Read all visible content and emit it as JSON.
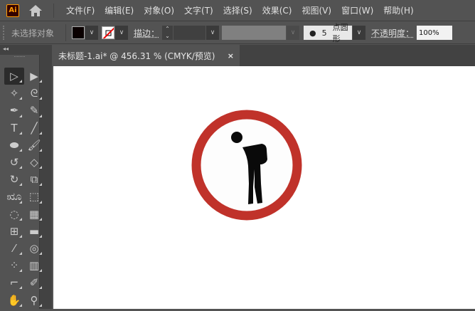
{
  "app": {
    "logo": "Ai"
  },
  "menu": [
    "文件(F)",
    "编辑(E)",
    "对象(O)",
    "文字(T)",
    "选择(S)",
    "效果(C)",
    "视图(V)",
    "窗口(W)",
    "帮助(H)"
  ],
  "control": {
    "selection_status": "未选择对象",
    "fill_color": "#0a0000",
    "stroke_label": "描边：",
    "brush_size": "5",
    "brush_name": "点圆形",
    "opacity_label": "不透明度：",
    "opacity_value": "100%"
  },
  "panel": {
    "collapse": "◂◂"
  },
  "document": {
    "tab_title": "未标题-1.ai* @ 456.31 % (CMYK/预览)",
    "close": "×"
  },
  "artwork": {
    "ring_color": "#c0322a",
    "figure_color": "#0a0a0a"
  },
  "tools": [
    {
      "name": "selection-tool",
      "glyph": "▷"
    },
    {
      "name": "direct-selection-tool",
      "glyph": "▶"
    },
    {
      "name": "magic-wand-tool",
      "glyph": "✧"
    },
    {
      "name": "lasso-tool",
      "glyph": "ᘓ"
    },
    {
      "name": "pen-tool",
      "glyph": "✒"
    },
    {
      "name": "curvature-tool",
      "glyph": "✎"
    },
    {
      "name": "type-tool",
      "glyph": "T"
    },
    {
      "name": "line-tool",
      "glyph": "╱"
    },
    {
      "name": "ellipse-tool",
      "glyph": "⬬"
    },
    {
      "name": "paintbrush-tool",
      "glyph": "🖌"
    },
    {
      "name": "shaper-tool",
      "glyph": "↺"
    },
    {
      "name": "eraser-tool",
      "glyph": "◇"
    },
    {
      "name": "rotate-tool",
      "glyph": "↻"
    },
    {
      "name": "scale-tool",
      "glyph": "⧉"
    },
    {
      "name": "warp-tool",
      "glyph": "ೠ"
    },
    {
      "name": "free-transform-tool",
      "glyph": "⬚"
    },
    {
      "name": "shape-builder-tool",
      "glyph": "◌"
    },
    {
      "name": "perspective-grid-tool",
      "glyph": "▦"
    },
    {
      "name": "mesh-tool",
      "glyph": "⊞"
    },
    {
      "name": "gradient-tool",
      "glyph": "▬"
    },
    {
      "name": "eyedropper-tool",
      "glyph": "⁄"
    },
    {
      "name": "blend-tool",
      "glyph": "◎"
    },
    {
      "name": "symbol-sprayer-tool",
      "glyph": "⁘"
    },
    {
      "name": "column-graph-tool",
      "glyph": "▥"
    },
    {
      "name": "artboard-tool",
      "glyph": "⌐"
    },
    {
      "name": "slice-tool",
      "glyph": "✐"
    },
    {
      "name": "hand-tool",
      "glyph": "✋"
    },
    {
      "name": "zoom-tool",
      "glyph": "⚲"
    }
  ]
}
